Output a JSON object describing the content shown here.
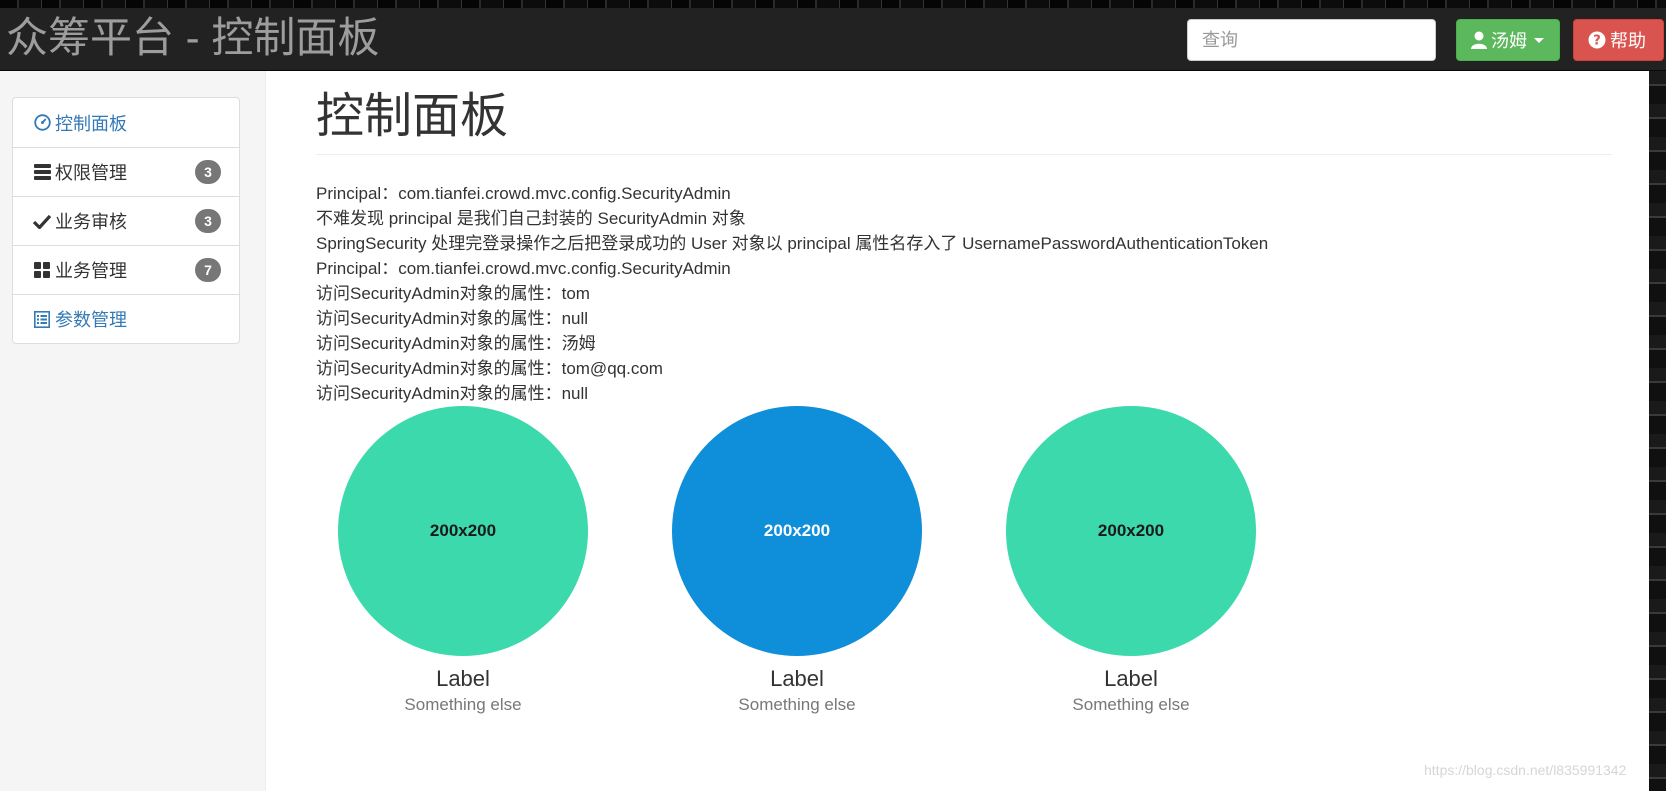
{
  "header": {
    "brand": "众筹平台 - 控制面板",
    "search": {
      "placeholder": "查询"
    },
    "user_button": {
      "label": "汤姆"
    },
    "help_button": {
      "label": "帮助"
    }
  },
  "sidebar": {
    "items": [
      {
        "label": "控制面板",
        "icon": "dashboard-icon"
      },
      {
        "label": "权限管理",
        "icon": "tasks-icon",
        "badge": "3"
      },
      {
        "label": "业务审核",
        "icon": "check-icon",
        "badge": "3"
      },
      {
        "label": "业务管理",
        "icon": "th-large-icon",
        "badge": "7"
      },
      {
        "label": "参数管理",
        "icon": "list-alt-icon"
      }
    ]
  },
  "main": {
    "title": "控制面板",
    "lines": [
      "Principal：com.tianfei.crowd.mvc.config.SecurityAdmin",
      "不难发现 principal 是我们自己封装的 SecurityAdmin 对象",
      "SpringSecurity 处理完登录操作之后把登录成功的 User 对象以 principal 属性名存入了 UsernamePasswordAuthenticationToken",
      "Principal：com.tianfei.crowd.mvc.config.SecurityAdmin",
      "访问SecurityAdmin对象的属性：tom",
      "访问SecurityAdmin对象的属性：null",
      "访问SecurityAdmin对象的属性：汤姆",
      "访问SecurityAdmin对象的属性：tom@qq.com",
      "访问SecurityAdmin对象的属性：null"
    ],
    "thumbnails": [
      {
        "image_text": "200x200",
        "label": "Label",
        "sub": "Something else",
        "color": "#3cd9ad",
        "text_color": "#1a1a1a"
      },
      {
        "image_text": "200x200",
        "label": "Label",
        "sub": "Something else",
        "color": "#0f8fd9",
        "text_color": "#ffffff"
      },
      {
        "image_text": "200x200",
        "label": "Label",
        "sub": "Something else",
        "color": "#3cd9ad",
        "text_color": "#1a1a1a"
      }
    ]
  },
  "watermark": "https://blog.csdn.net/l835991342",
  "colors": {
    "navbar": "#222222",
    "success": "#5cb85c",
    "danger": "#d9534f",
    "link": "#337ab7",
    "badge": "#777777"
  }
}
